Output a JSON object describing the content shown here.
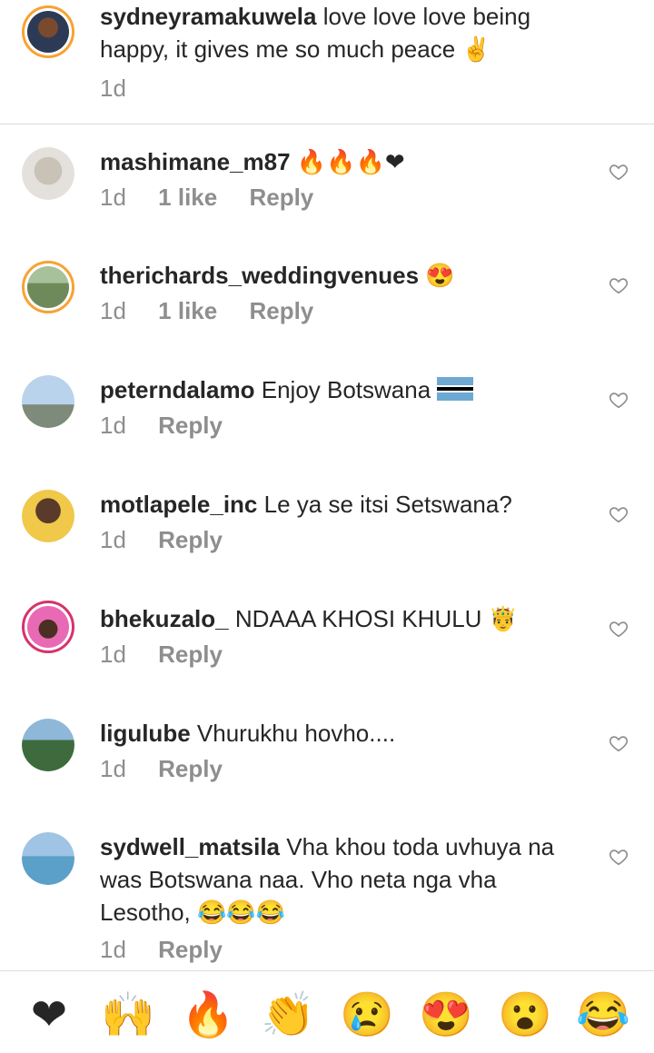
{
  "caption": {
    "username": "sydneyramakuwela",
    "text": "love love love being happy, it gives me so much peace",
    "emoji": "✌",
    "time": "1d"
  },
  "comments": [
    {
      "username": "mashimane_m87",
      "text": "",
      "emoji": "🔥🔥🔥❤",
      "time": "1d",
      "likes": "1 like",
      "reply": "Reply"
    },
    {
      "username": "therichards_weddingvenues",
      "text": "",
      "emoji": "😍",
      "time": "1d",
      "likes": "1 like",
      "reply": "Reply"
    },
    {
      "username": "peterndalamo",
      "text": "Enjoy Botswana",
      "emoji": "",
      "time": "1d",
      "likes": "",
      "reply": "Reply"
    },
    {
      "username": "motlapele_inc",
      "text": "Le ya se itsi Setswana?",
      "emoji": "",
      "time": "1d",
      "likes": "",
      "reply": "Reply"
    },
    {
      "username": "bhekuzalo_",
      "text": "NDAAA KHOSI KHULU",
      "emoji": "🤴",
      "time": "1d",
      "likes": "",
      "reply": "Reply"
    },
    {
      "username": "ligulube",
      "text": "Vhurukhu hovho....",
      "emoji": "",
      "time": "1d",
      "likes": "",
      "reply": "Reply"
    },
    {
      "username": "sydwell_matsila",
      "text": "Vha khou toda uvhuya na was Botswana naa. Vho neta nga vha Lesotho,",
      "emoji": "😂😂😂",
      "time": "1d",
      "likes": "",
      "reply": "Reply"
    }
  ],
  "reaction_bar": [
    "❤",
    "🙌",
    "🔥",
    "👏",
    "😢",
    "😍",
    "😮",
    "😂"
  ],
  "icons": {
    "comment_like": "heart-outline-icon",
    "flag": "botswana-flag-icon"
  }
}
